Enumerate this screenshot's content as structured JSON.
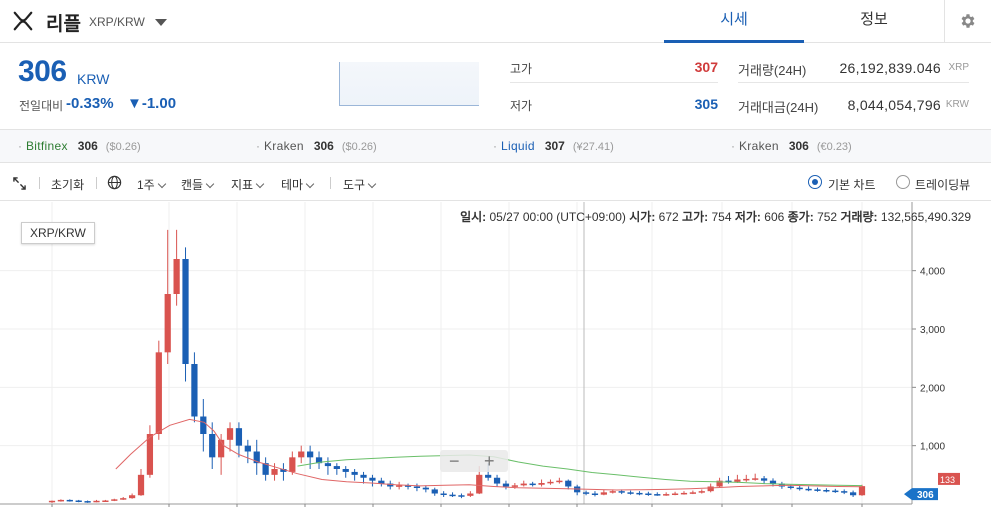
{
  "header": {
    "coin_name": "리플",
    "coin_pair": "XRP/KRW",
    "tabs": [
      {
        "label": "시세"
      },
      {
        "label": "정보"
      }
    ],
    "icons": {
      "logo": "xrp-logo-icon",
      "dropdown": "triangle-down-icon",
      "settings": "gear-icon"
    }
  },
  "summary": {
    "price": "306",
    "unit": "KRW",
    "change_label": "전일대비",
    "change_pct": "-0.33%",
    "change_abs": "▼-1.00",
    "high_label": "고가",
    "high_value": "307",
    "low_label": "저가",
    "low_value": "305",
    "volume_label": "거래량(24H)",
    "volume_value": "26,192,839.046",
    "volume_unit": "XRP",
    "amount_label": "거래대금(24H)",
    "amount_value": "8,044,054,796",
    "amount_unit": "KRW"
  },
  "exchanges": [
    {
      "name": "Bitfinex",
      "price": "306",
      "sub": "($0.26)",
      "color": "#2e7d32"
    },
    {
      "name": "Kraken",
      "price": "306",
      "sub": "($0.26)",
      "color": "#555555"
    },
    {
      "name": "Liquid",
      "price": "307",
      "sub": "(¥27.41)",
      "color": "#1a5fb4"
    },
    {
      "name": "Kraken",
      "price": "306",
      "sub": "(€0.23)",
      "color": "#555555"
    }
  ],
  "toolbar": {
    "reset": "초기화",
    "interval": "1주",
    "candle": "캔들",
    "indicator": "지표",
    "theme": "테마",
    "tools": "도구",
    "basic_chart": "기본 차트",
    "tradingview": "트레이딩뷰"
  },
  "ohlc": {
    "date_label": "일시:",
    "date": "05/27 00:00 (UTC+09:00)",
    "open_label": "시가:",
    "open": "672",
    "high_label": "고가:",
    "high": "754",
    "low_label": "저가:",
    "low": "606",
    "close_label": "종가:",
    "close": "752",
    "volume_label": "거래량:",
    "volume": "132,565,490.329"
  },
  "chart_data": {
    "type": "candlestick",
    "legend": "XRP/KRW",
    "y_ticks": [
      "1,000",
      "2,000",
      "3,000",
      "4,000"
    ],
    "ylim": [
      0,
      4800
    ],
    "last_price_tag": "306",
    "second_tag": "133",
    "colors": {
      "up": "#d9534f",
      "down": "#1a5fb4",
      "ma_red": "#e06666",
      "ma_green": "#6abf69"
    },
    "candles": [
      [
        40,
        55,
        20,
        60
      ],
      [
        55,
        70,
        40,
        80
      ],
      [
        70,
        60,
        40,
        80
      ],
      [
        60,
        50,
        30,
        70
      ],
      [
        50,
        40,
        20,
        60
      ],
      [
        40,
        55,
        30,
        70
      ],
      [
        55,
        60,
        40,
        70
      ],
      [
        60,
        80,
        50,
        90
      ],
      [
        80,
        100,
        70,
        120
      ],
      [
        100,
        150,
        90,
        180
      ],
      [
        150,
        500,
        140,
        600
      ],
      [
        500,
        1200,
        450,
        1350
      ],
      [
        1200,
        2600,
        1100,
        2800
      ],
      [
        2600,
        3600,
        2400,
        4700
      ],
      [
        3600,
        4200,
        3400,
        4700
      ],
      [
        4200,
        2400,
        2100,
        4400
      ],
      [
        2400,
        1500,
        1400,
        2600
      ],
      [
        1500,
        1200,
        900,
        1800
      ],
      [
        1200,
        800,
        600,
        1400
      ],
      [
        800,
        1100,
        500,
        1200
      ],
      [
        1100,
        1300,
        900,
        1400
      ],
      [
        1300,
        1000,
        800,
        1400
      ],
      [
        1000,
        900,
        700,
        1100
      ],
      [
        900,
        700,
        500,
        1100
      ],
      [
        700,
        500,
        400,
        800
      ],
      [
        500,
        600,
        400,
        700
      ],
      [
        600,
        550,
        400,
        700
      ],
      [
        550,
        800,
        500,
        900
      ],
      [
        800,
        900,
        700,
        1000
      ],
      [
        900,
        800,
        600,
        1000
      ],
      [
        800,
        700,
        600,
        900
      ],
      [
        700,
        650,
        500,
        800
      ],
      [
        650,
        600,
        500,
        700
      ],
      [
        600,
        550,
        450,
        650
      ],
      [
        550,
        500,
        400,
        600
      ],
      [
        500,
        450,
        350,
        550
      ],
      [
        450,
        400,
        300,
        500
      ],
      [
        400,
        350,
        300,
        450
      ],
      [
        350,
        300,
        250,
        400
      ],
      [
        300,
        320,
        250,
        380
      ],
      [
        320,
        300,
        250,
        350
      ],
      [
        300,
        280,
        220,
        350
      ],
      [
        280,
        250,
        200,
        320
      ],
      [
        250,
        180,
        140,
        280
      ],
      [
        180,
        160,
        120,
        220
      ],
      [
        160,
        150,
        120,
        200
      ],
      [
        150,
        140,
        100,
        180
      ],
      [
        140,
        180,
        120,
        220
      ],
      [
        180,
        500,
        170,
        650
      ],
      [
        500,
        450,
        400,
        700
      ],
      [
        450,
        350,
        300,
        500
      ],
      [
        350,
        300,
        250,
        400
      ],
      [
        300,
        320,
        260,
        360
      ],
      [
        320,
        350,
        300,
        400
      ],
      [
        350,
        330,
        300,
        380
      ],
      [
        330,
        360,
        300,
        420
      ],
      [
        360,
        380,
        330,
        420
      ],
      [
        380,
        400,
        350,
        450
      ],
      [
        400,
        300,
        250,
        420
      ],
      [
        300,
        200,
        150,
        330
      ],
      [
        200,
        180,
        150,
        230
      ],
      [
        180,
        160,
        130,
        220
      ],
      [
        160,
        200,
        150,
        240
      ],
      [
        200,
        220,
        180,
        250
      ],
      [
        220,
        200,
        170,
        250
      ],
      [
        200,
        190,
        160,
        230
      ],
      [
        190,
        180,
        150,
        220
      ],
      [
        180,
        170,
        140,
        210
      ],
      [
        170,
        160,
        140,
        200
      ],
      [
        160,
        170,
        140,
        200
      ],
      [
        170,
        180,
        150,
        210
      ],
      [
        180,
        190,
        160,
        220
      ],
      [
        190,
        200,
        170,
        230
      ],
      [
        200,
        220,
        180,
        250
      ],
      [
        220,
        300,
        200,
        350
      ],
      [
        300,
        400,
        280,
        450
      ],
      [
        400,
        380,
        350,
        480
      ],
      [
        380,
        420,
        360,
        500
      ],
      [
        420,
        430,
        380,
        500
      ],
      [
        430,
        440,
        400,
        520
      ],
      [
        440,
        400,
        350,
        480
      ],
      [
        400,
        350,
        300,
        440
      ],
      [
        350,
        300,
        260,
        380
      ],
      [
        300,
        280,
        250,
        330
      ],
      [
        280,
        260,
        230,
        310
      ],
      [
        260,
        250,
        220,
        300
      ],
      [
        250,
        240,
        210,
        280
      ],
      [
        240,
        230,
        200,
        270
      ],
      [
        230,
        220,
        190,
        260
      ],
      [
        220,
        200,
        170,
        250
      ],
      [
        200,
        150,
        120,
        230
      ],
      [
        150,
        306,
        140,
        330
      ]
    ],
    "ma_red": [
      [
        13,
        600
      ],
      [
        16,
        850
      ],
      [
        20,
        1150
      ],
      [
        24,
        1350
      ],
      [
        28,
        1450
      ],
      [
        31,
        1400
      ],
      [
        33,
        1250
      ],
      [
        35,
        1000
      ],
      [
        38,
        850
      ],
      [
        42,
        720
      ],
      [
        46,
        620
      ],
      [
        50,
        520
      ],
      [
        55,
        420
      ],
      [
        60,
        380
      ],
      [
        65,
        360
      ],
      [
        70,
        330
      ],
      [
        75,
        310
      ],
      [
        80,
        320
      ],
      [
        85,
        330
      ],
      [
        90,
        300
      ],
      [
        95,
        280
      ],
      [
        100,
        270
      ],
      [
        105,
        260
      ],
      [
        110,
        250
      ],
      [
        115,
        240
      ],
      [
        120,
        245
      ],
      [
        125,
        250
      ],
      [
        130,
        260
      ],
      [
        135,
        280
      ],
      [
        140,
        300
      ],
      [
        145,
        310
      ],
      [
        150,
        320
      ],
      [
        155,
        310
      ],
      [
        160,
        300
      ],
      [
        165,
        295
      ]
    ],
    "ma_green": [
      [
        50,
        650
      ],
      [
        55,
        720
      ],
      [
        60,
        760
      ],
      [
        65,
        780
      ],
      [
        70,
        800
      ],
      [
        75,
        820
      ],
      [
        80,
        830
      ],
      [
        85,
        840
      ],
      [
        90,
        810
      ],
      [
        95,
        720
      ],
      [
        100,
        650
      ],
      [
        105,
        600
      ],
      [
        110,
        540
      ],
      [
        115,
        500
      ],
      [
        120,
        460
      ],
      [
        125,
        420
      ],
      [
        130,
        390
      ],
      [
        135,
        380
      ],
      [
        140,
        370
      ],
      [
        145,
        350
      ],
      [
        150,
        340
      ],
      [
        155,
        330
      ],
      [
        160,
        320
      ],
      [
        165,
        315
      ]
    ]
  }
}
